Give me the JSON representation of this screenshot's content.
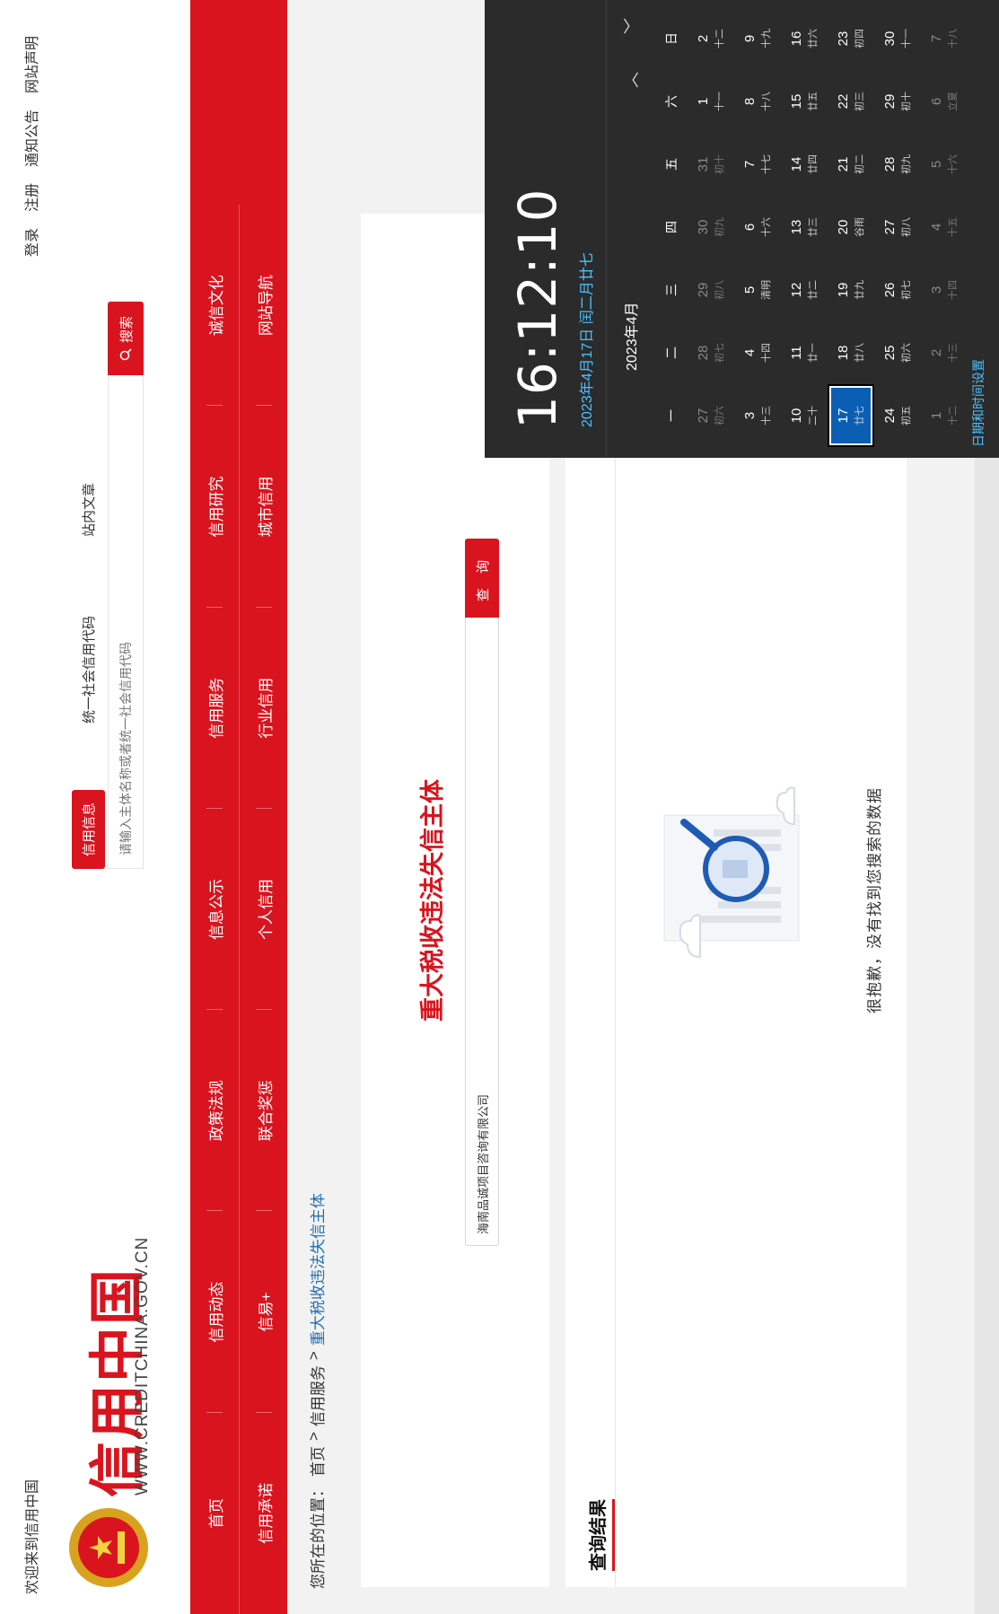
{
  "topbar": {
    "welcome": "欢迎来到信用中国",
    "links": [
      "登录",
      "注册",
      "通知公告",
      "网站声明"
    ]
  },
  "header": {
    "logo_cn": "信用中国",
    "logo_en": "WWW.CREDITCHINA.GOV.CN",
    "search_tabs": [
      "信用信息",
      "统一社会信用代码",
      "站内文章"
    ],
    "search_placeholder": "请输入主体名称或者统一社会信用代码",
    "search_button": "搜索"
  },
  "nav": {
    "row1": [
      "首页",
      "信用动态",
      "政策法规",
      "信息公示",
      "信用服务",
      "信用研究",
      "诚信文化"
    ],
    "row2": [
      "信用承诺",
      "信易+",
      "联合奖惩",
      "个人信用",
      "行业信用",
      "城市信用",
      "网站导航"
    ]
  },
  "breadcrumb": {
    "prefix": "您所在的位置：",
    "items": [
      "首页",
      "信用服务",
      "重大税收违法失信主体"
    ],
    "separator": ">"
  },
  "query": {
    "title": "重大税收违法失信主体",
    "input_value": "海南品诚项目咨询有限公司",
    "button": "查 询"
  },
  "results": {
    "title": "查询结果",
    "empty_text": "很抱歉，没有找到您搜索的数据"
  },
  "clock": {
    "time": "16:12:10",
    "date": "2023年4月17日 闰二月廿七",
    "month": "2023年4月",
    "weekdays": [
      "一",
      "二",
      "三",
      "四",
      "五",
      "六",
      "日"
    ],
    "weeks": [
      [
        {
          "d": "27",
          "l": "初六",
          "dim": true
        },
        {
          "d": "28",
          "l": "初七",
          "dim": true
        },
        {
          "d": "29",
          "l": "初八",
          "dim": true
        },
        {
          "d": "30",
          "l": "初九",
          "dim": true
        },
        {
          "d": "31",
          "l": "初十",
          "dim": true
        },
        {
          "d": "1",
          "l": "十一"
        },
        {
          "d": "2",
          "l": "十二"
        }
      ],
      [
        {
          "d": "3",
          "l": "十三"
        },
        {
          "d": "4",
          "l": "十四"
        },
        {
          "d": "5",
          "l": "清明"
        },
        {
          "d": "6",
          "l": "十六"
        },
        {
          "d": "7",
          "l": "十七"
        },
        {
          "d": "8",
          "l": "十八"
        },
        {
          "d": "9",
          "l": "十九"
        }
      ],
      [
        {
          "d": "10",
          "l": "二十"
        },
        {
          "d": "11",
          "l": "廿一"
        },
        {
          "d": "12",
          "l": "廿二"
        },
        {
          "d": "13",
          "l": "廿三"
        },
        {
          "d": "14",
          "l": "廿四"
        },
        {
          "d": "15",
          "l": "廿五"
        },
        {
          "d": "16",
          "l": "廿六"
        }
      ],
      [
        {
          "d": "17",
          "l": "廿七",
          "today": true
        },
        {
          "d": "18",
          "l": "廿八"
        },
        {
          "d": "19",
          "l": "廿九"
        },
        {
          "d": "20",
          "l": "谷雨"
        },
        {
          "d": "21",
          "l": "初二"
        },
        {
          "d": "22",
          "l": "初三"
        },
        {
          "d": "23",
          "l": "初四"
        }
      ],
      [
        {
          "d": "24",
          "l": "初五"
        },
        {
          "d": "25",
          "l": "初六"
        },
        {
          "d": "26",
          "l": "初七"
        },
        {
          "d": "27",
          "l": "初八"
        },
        {
          "d": "28",
          "l": "初九"
        },
        {
          "d": "29",
          "l": "初十"
        },
        {
          "d": "30",
          "l": "十一"
        }
      ],
      [
        {
          "d": "1",
          "l": "十二",
          "dim": true
        },
        {
          "d": "2",
          "l": "十三",
          "dim": true
        },
        {
          "d": "3",
          "l": "十四",
          "dim": true
        },
        {
          "d": "4",
          "l": "十五",
          "dim": true
        },
        {
          "d": "5",
          "l": "十六",
          "dim": true
        },
        {
          "d": "6",
          "l": "立夏",
          "dim": true
        },
        {
          "d": "7",
          "l": "十八",
          "dim": true
        }
      ]
    ],
    "settings_link": "日期和时间设置"
  },
  "colors": {
    "brand_red": "#d9141e",
    "link_blue": "#1f6fb5",
    "flyout_bg": "#2b2b2b",
    "accent_blue": "#4cc2ff",
    "today_bg": "#0a5fb4"
  },
  "icons": {
    "search": "search-icon",
    "emblem": "national-emblem-icon",
    "chevron_up": "chevron-up-icon",
    "chevron_down": "chevron-down-icon",
    "no_result": "magnifier-document-illustration"
  }
}
